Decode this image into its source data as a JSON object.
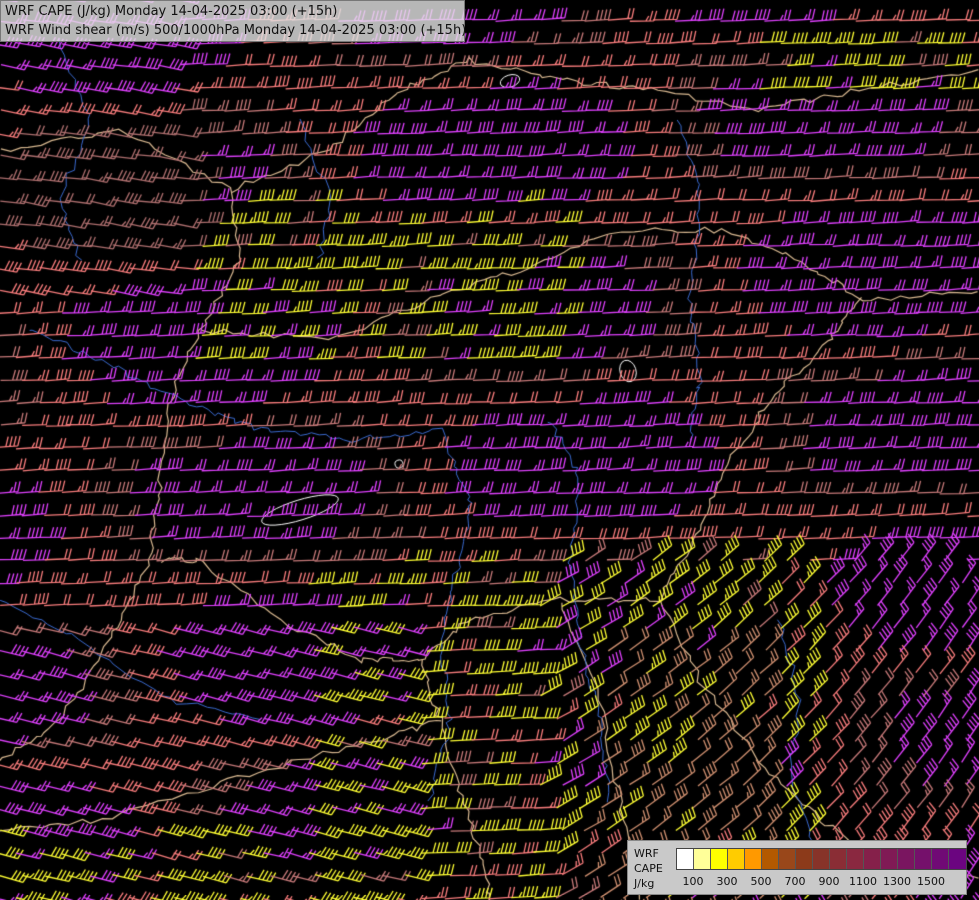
{
  "titles": {
    "line1": "WRF CAPE (J/kg) Monday 14-04-2025 03:00 (+15h)",
    "line2": "WRF Wind shear (m/s) 500/1000hPa Monday 14-04-2025 03:00 (+15h)"
  },
  "legend": {
    "label_model": "WRF",
    "label_field": "CAPE",
    "label_unit": "J/kg",
    "colors": [
      "#ffffff",
      "#ffff99",
      "#ffff00",
      "#ffcc00",
      "#ff9900",
      "#b35900",
      "#99471a",
      "#8c3a1a",
      "#873329",
      "#8a2d35",
      "#8a2840",
      "#85204a",
      "#801a55",
      "#7a1560",
      "#75106b",
      "#700a75",
      "#6b0580"
    ],
    "ticks": [
      "100",
      "300",
      "500",
      "700",
      "900",
      "1100",
      "1300",
      "1500"
    ]
  },
  "barb_palette": [
    "#e040ff",
    "#fa7d7d",
    "#ffff33",
    "#c87a7a",
    "#d09070",
    "#b07070"
  ]
}
